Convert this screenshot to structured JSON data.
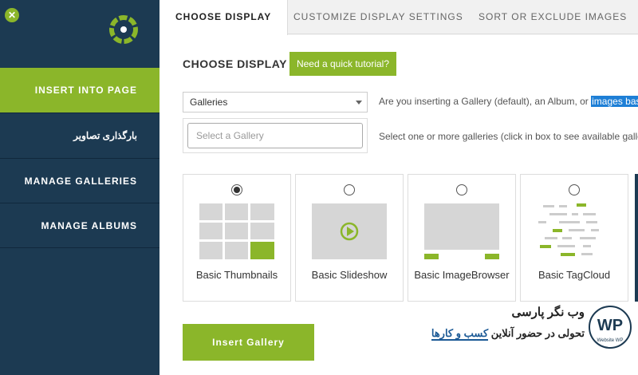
{
  "colors": {
    "accent": "#8bb62a",
    "sidebar": "#1c3a52",
    "highlight": "#1e7fd6"
  },
  "sidebar": {
    "close_icon": "close-icon",
    "logo_icon": "nextgen-logo-icon",
    "items": [
      {
        "label": "Insert Into Page",
        "active": true
      },
      {
        "label": "بارگذاری تصاویر",
        "active": false
      },
      {
        "label": "Manage Galleries",
        "active": false
      },
      {
        "label": "Manage Albums",
        "active": false
      }
    ]
  },
  "tabs": [
    {
      "label": "Choose Display",
      "active": true
    },
    {
      "label": "Customize Display Settings",
      "active": false
    },
    {
      "label": "Sort or Exclude Images",
      "active": false
    }
  ],
  "main": {
    "title": "Choose Display",
    "tutorial_button": "Need a quick tutorial?",
    "type_select": {
      "value": "Galleries"
    },
    "type_help_before": "Are you inserting a Gallery (default), an Album, or ",
    "type_help_highlight": "images based",
    "gallery_select": {
      "placeholder": "Select a Gallery"
    },
    "gallery_help": "Select one or more galleries (click in box to see available galleries).",
    "display_types": [
      {
        "label": "Basic Thumbnails",
        "selected": true
      },
      {
        "label": "Basic Slideshow",
        "selected": false
      },
      {
        "label": "Basic ImageBrowser",
        "selected": false
      },
      {
        "label": "Basic TagCloud",
        "selected": false
      }
    ],
    "insert_button": "Insert Gallery"
  },
  "watermark": {
    "title": "وب نگر پارسی",
    "subtitle_before": "تحولی در حضور آنلاین ",
    "subtitle_underlined": "کسب و کارها",
    "logo_text": "WP",
    "logo_caption": "Website WP"
  }
}
